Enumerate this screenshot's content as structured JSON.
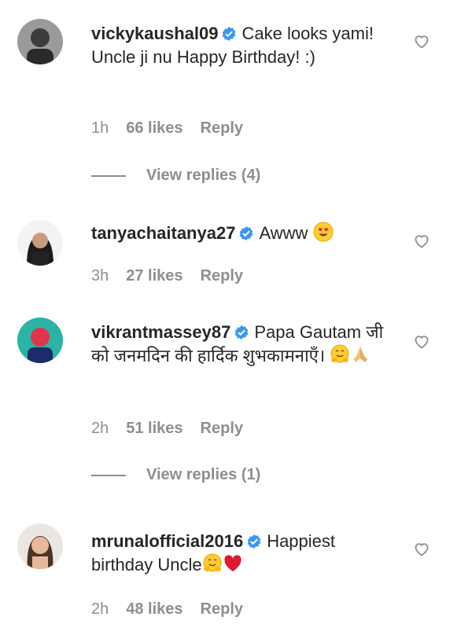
{
  "comments": [
    {
      "username": "vickykaushal09",
      "text": "Cake looks yami! Uncle ji nu Happy Birthday! :)",
      "time": "1h",
      "likes": "66 likes",
      "reply": "Reply",
      "view_replies": "View replies (4)"
    },
    {
      "username": "tanyachaitanya27",
      "text": "Awww",
      "emoji": [
        "heart-eyes-emoji"
      ],
      "time": "3h",
      "likes": "27 likes",
      "reply": "Reply"
    },
    {
      "username": "vikrantmassey87",
      "text": "Papa Gautam जी को जनमदिन की हार्दिक शुभकामनाएँ।",
      "emoji": [
        "smiling-hug-emoji",
        "folded-hands-emoji"
      ],
      "time": "2h",
      "likes": "51 likes",
      "reply": "Reply",
      "view_replies": "View replies (1)"
    },
    {
      "username": "mrunalofficial2016",
      "text": "Happiest birthday Uncle",
      "emoji": [
        "smiling-hug-emoji",
        "red-heart-emoji"
      ],
      "time": "2h",
      "likes": "48 likes",
      "reply": "Reply"
    }
  ],
  "icons": {
    "verified": "verified-badge-icon",
    "like": "heart-outline-icon"
  },
  "colors": {
    "text": "#262626",
    "meta": "#8e8e8e",
    "verified": "#3897f0"
  }
}
